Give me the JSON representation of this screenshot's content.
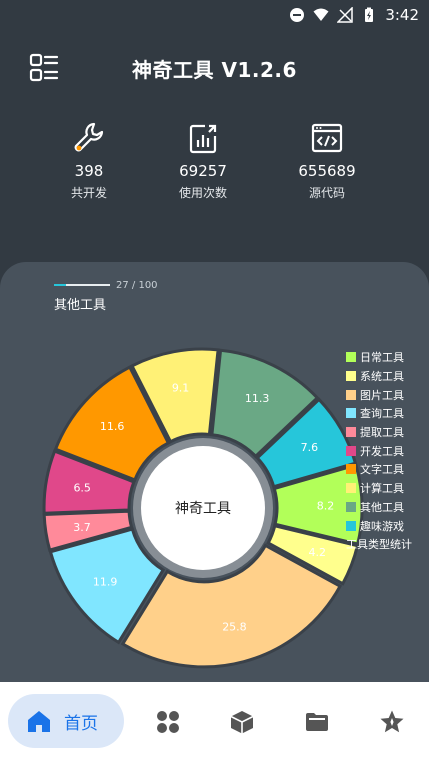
{
  "status_bar": {
    "time": "3:42"
  },
  "header": {
    "title": "神奇工具 V1.2.6"
  },
  "stats": [
    {
      "value": "398",
      "label": "共开发",
      "icon": "wrench-icon"
    },
    {
      "value": "69257",
      "label": "使用次数",
      "icon": "bar-chart-icon"
    },
    {
      "value": "655689",
      "label": "源代码",
      "icon": "code-window-icon"
    }
  ],
  "card": {
    "progress_fragment": "27 / 100",
    "section_title": "其他工具"
  },
  "chart_data": {
    "type": "pie",
    "center_label": "神奇工具",
    "legend_title": "工具类型统计",
    "slices": [
      {
        "name": "日常工具",
        "value": 8.2,
        "color": "#b2ff59",
        "label": "8.2"
      },
      {
        "name": "系统工具",
        "value": 4.2,
        "color": "#ffff8d",
        "label": "4.2"
      },
      {
        "name": "图片工具",
        "value": 25.8,
        "color": "#ffd08a",
        "label": "25.8"
      },
      {
        "name": "查询工具",
        "value": 11.9,
        "color": "#80e6ff",
        "label": "11.9"
      },
      {
        "name": "提取工具",
        "value": 3.7,
        "color": "#ff8a9a",
        "label": "3.7"
      },
      {
        "name": "开发工具",
        "value": 6.5,
        "color": "#e0488a",
        "label": "6.5"
      },
      {
        "name": "文字工具",
        "value": 11.6,
        "color": "#ff9800",
        "label": "11.6"
      },
      {
        "name": "计算工具",
        "value": 9.1,
        "color": "#fff176",
        "label": "9.1"
      },
      {
        "name": "其他工具",
        "value": 11.3,
        "color": "#6aa885",
        "label": "11.3"
      },
      {
        "name": "趣味游戏",
        "value": 7.6,
        "color": "#26c6da",
        "label": "7.6"
      }
    ]
  },
  "bottom_nav": {
    "home_label": "首页",
    "items": [
      "home-icon",
      "apps-grid-icon",
      "box-icon",
      "folder-icon",
      "star-icon"
    ]
  }
}
